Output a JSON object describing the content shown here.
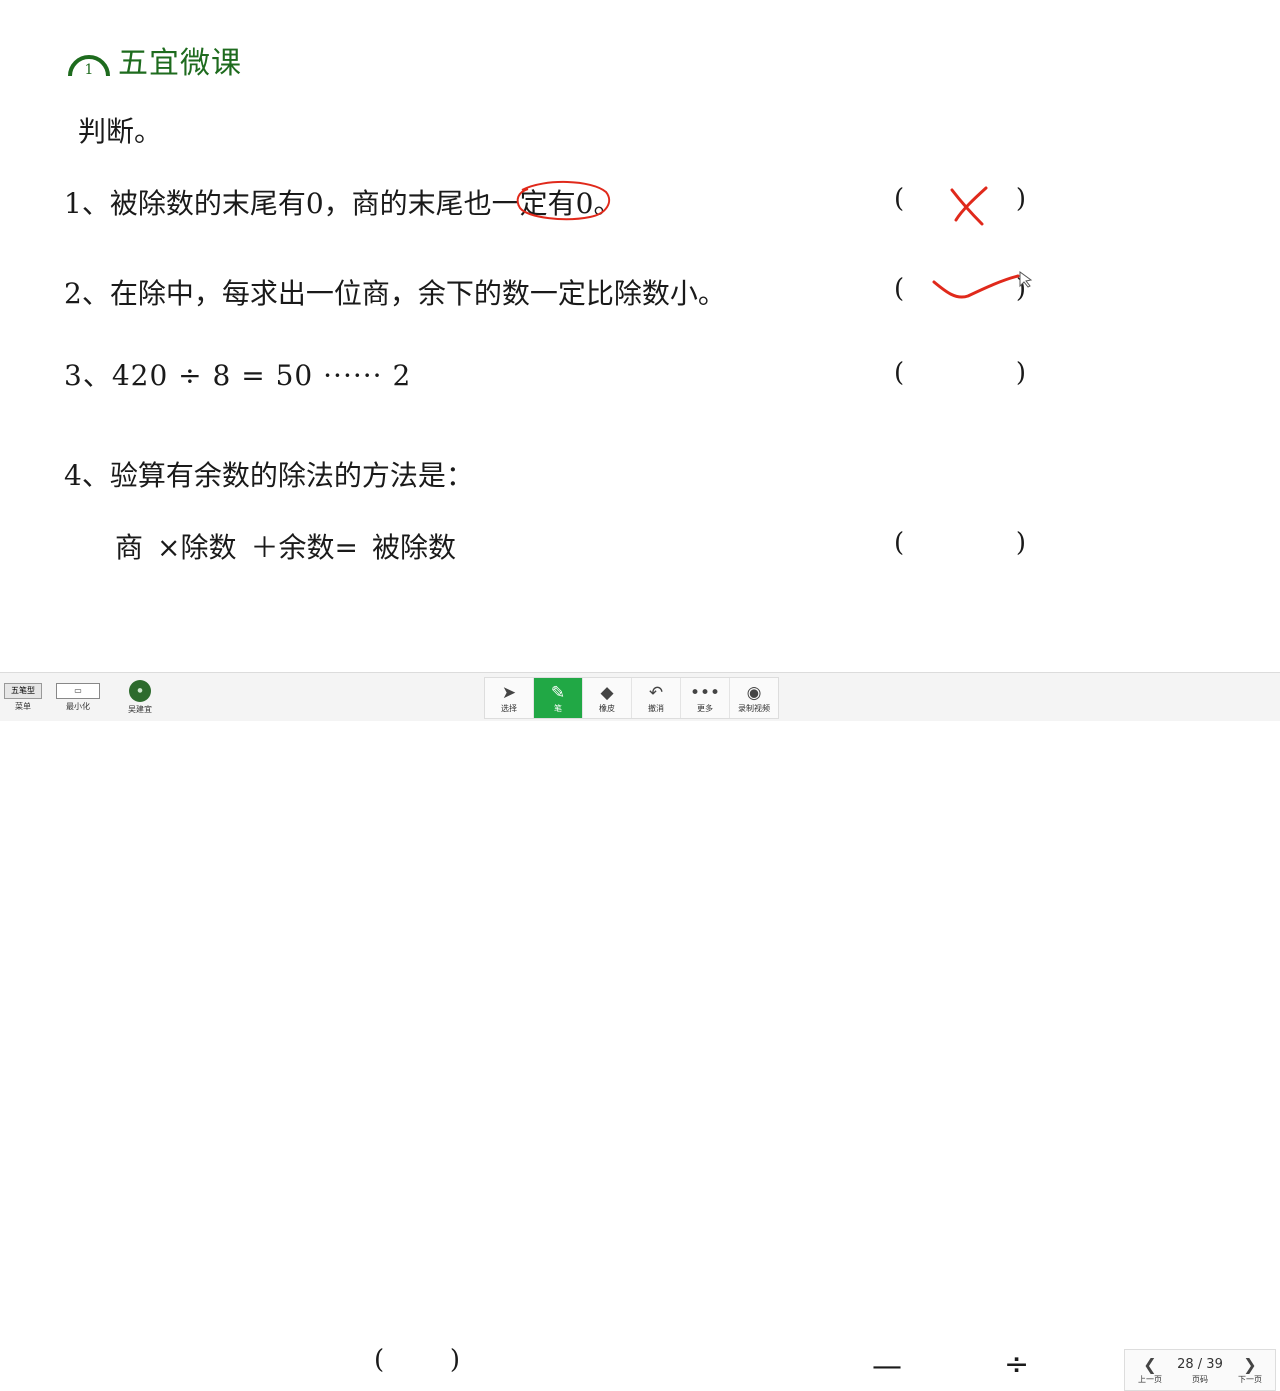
{
  "brand": {
    "logo_digit": "1",
    "name": "五宜微课"
  },
  "heading": "判断。",
  "questions": [
    {
      "num": "1、",
      "text_a": "被除数的末尾有0，商的末尾",
      "text_circled": "也一定",
      "text_b": "有0。"
    },
    {
      "num": "2、",
      "text": "在除中，每求出一位商，余下的数一定比除数小。"
    },
    {
      "num": "3、",
      "expr": "420 ÷ 8 = 50 ······ 2"
    },
    {
      "num": "4、",
      "text": "验算有余数的除法的方法是："
    }
  ],
  "formula": {
    "a": "商",
    "op1": "×",
    "b": "除数",
    "op2": "＋",
    "c": "余数",
    "op3": "=",
    "d": "被除数"
  },
  "paren": {
    "open": "(",
    "close": ")"
  },
  "toolbar": {
    "menu_label": "菜单",
    "menu_thumb": "五笔型",
    "minimize_label": "最小化",
    "user_label": "吴建宜",
    "tools": [
      {
        "name": "select",
        "icon": "➤",
        "label": "选择"
      },
      {
        "name": "pen",
        "icon": "✎",
        "label": "笔"
      },
      {
        "name": "eraser",
        "icon": "◆",
        "label": "橡皮"
      },
      {
        "name": "undo",
        "icon": "↶",
        "label": "撤消"
      },
      {
        "name": "more",
        "icon": "•••",
        "label": "更多"
      },
      {
        "name": "record",
        "icon": "◉",
        "label": "录制视频"
      }
    ],
    "minus": "—",
    "divide": "÷",
    "prev_label": "上一页",
    "page_display": "28 / 39",
    "page_label": "页码",
    "next_label": "下一页"
  },
  "colors": {
    "brand": "#1e6b1e",
    "ink": "#e0291b",
    "active": "#21a845"
  }
}
